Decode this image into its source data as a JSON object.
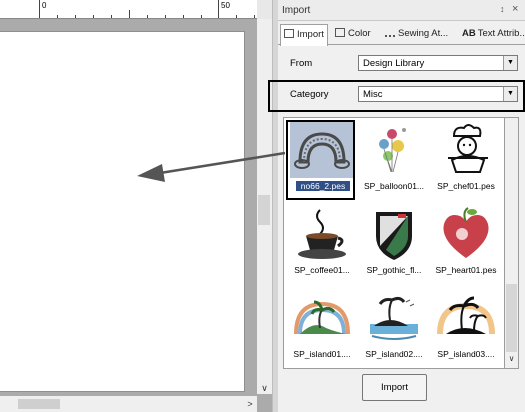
{
  "ruler": {
    "labels": [
      "0",
      "50"
    ]
  },
  "panel": {
    "title": "Import",
    "pin_icon": "pin-icon",
    "close_icon": "close-icon"
  },
  "tabs": [
    {
      "label": "Import",
      "icon": "import-tab-icon",
      "active": true
    },
    {
      "label": "Color",
      "icon": "color-tab-icon",
      "active": false
    },
    {
      "label": "Sewing At...",
      "icon": "sewing-tab-icon",
      "active": false
    },
    {
      "label": "Text Attrib...",
      "icon": "text-tab-icon",
      "prefix": "AB",
      "active": false
    }
  ],
  "from": {
    "label": "From",
    "value": "Design Library"
  },
  "category": {
    "label": "Category",
    "value": "Misc"
  },
  "library": {
    "items": [
      {
        "label": "no66_2.pes",
        "icon": "rainbow-icon",
        "selected": true
      },
      {
        "label": "SP_balloon01...",
        "icon": "balloon-icon",
        "selected": false
      },
      {
        "label": "SP_chef01.pes",
        "icon": "chef-icon",
        "selected": false
      },
      {
        "label": "SP_coffee01...",
        "icon": "coffee-icon",
        "selected": false
      },
      {
        "label": "SP_gothic_fl...",
        "icon": "gothic-shield-icon",
        "selected": false
      },
      {
        "label": "SP_heart01.pes",
        "icon": "heart-icon",
        "selected": false
      },
      {
        "label": "SP_island01....",
        "icon": "island-icon",
        "selected": false
      },
      {
        "label": "SP_island02....",
        "icon": "island-icon",
        "selected": false
      },
      {
        "label": "SP_island03....",
        "icon": "island-icon",
        "selected": false
      }
    ]
  },
  "import_button": {
    "label": "Import"
  },
  "colors": {
    "selection": "#2f4f86",
    "arrow": "#555555"
  }
}
